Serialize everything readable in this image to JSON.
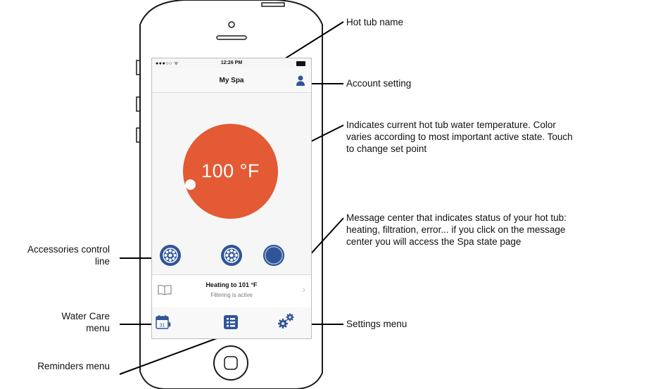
{
  "screen": {
    "status_bar": {
      "carrier": "●●●○○ ᯤ",
      "time": "12:26 PM"
    },
    "nav": {
      "title": "My Spa"
    },
    "temperature": {
      "value": "100 °F",
      "color": "#e35a35"
    },
    "message_center": {
      "line1": "Heating to 101 °F",
      "line2": "Filtering is active"
    },
    "accent_color": "#2f5597"
  },
  "annotations": {
    "hot_tub_name": "Hot tub name",
    "account_setting": "Account setting",
    "temperature_line1": "Indicates current hot tub water temperature. Color",
    "temperature_line2": "varies according to most important active state. Touch",
    "temperature_line3": "to change set point",
    "message_line1": "Message center that indicates status of your hot tub:",
    "message_line2": "heating, filtration, error... if you click on the message",
    "message_line3": "center you will access the Spa state page",
    "accessories_line1": "Accessories control",
    "accessories_line2": "line",
    "water_care_line1": "Water Care",
    "water_care_line2": "menu",
    "settings_menu": "Settings menu",
    "reminders_menu": "Reminders menu"
  }
}
